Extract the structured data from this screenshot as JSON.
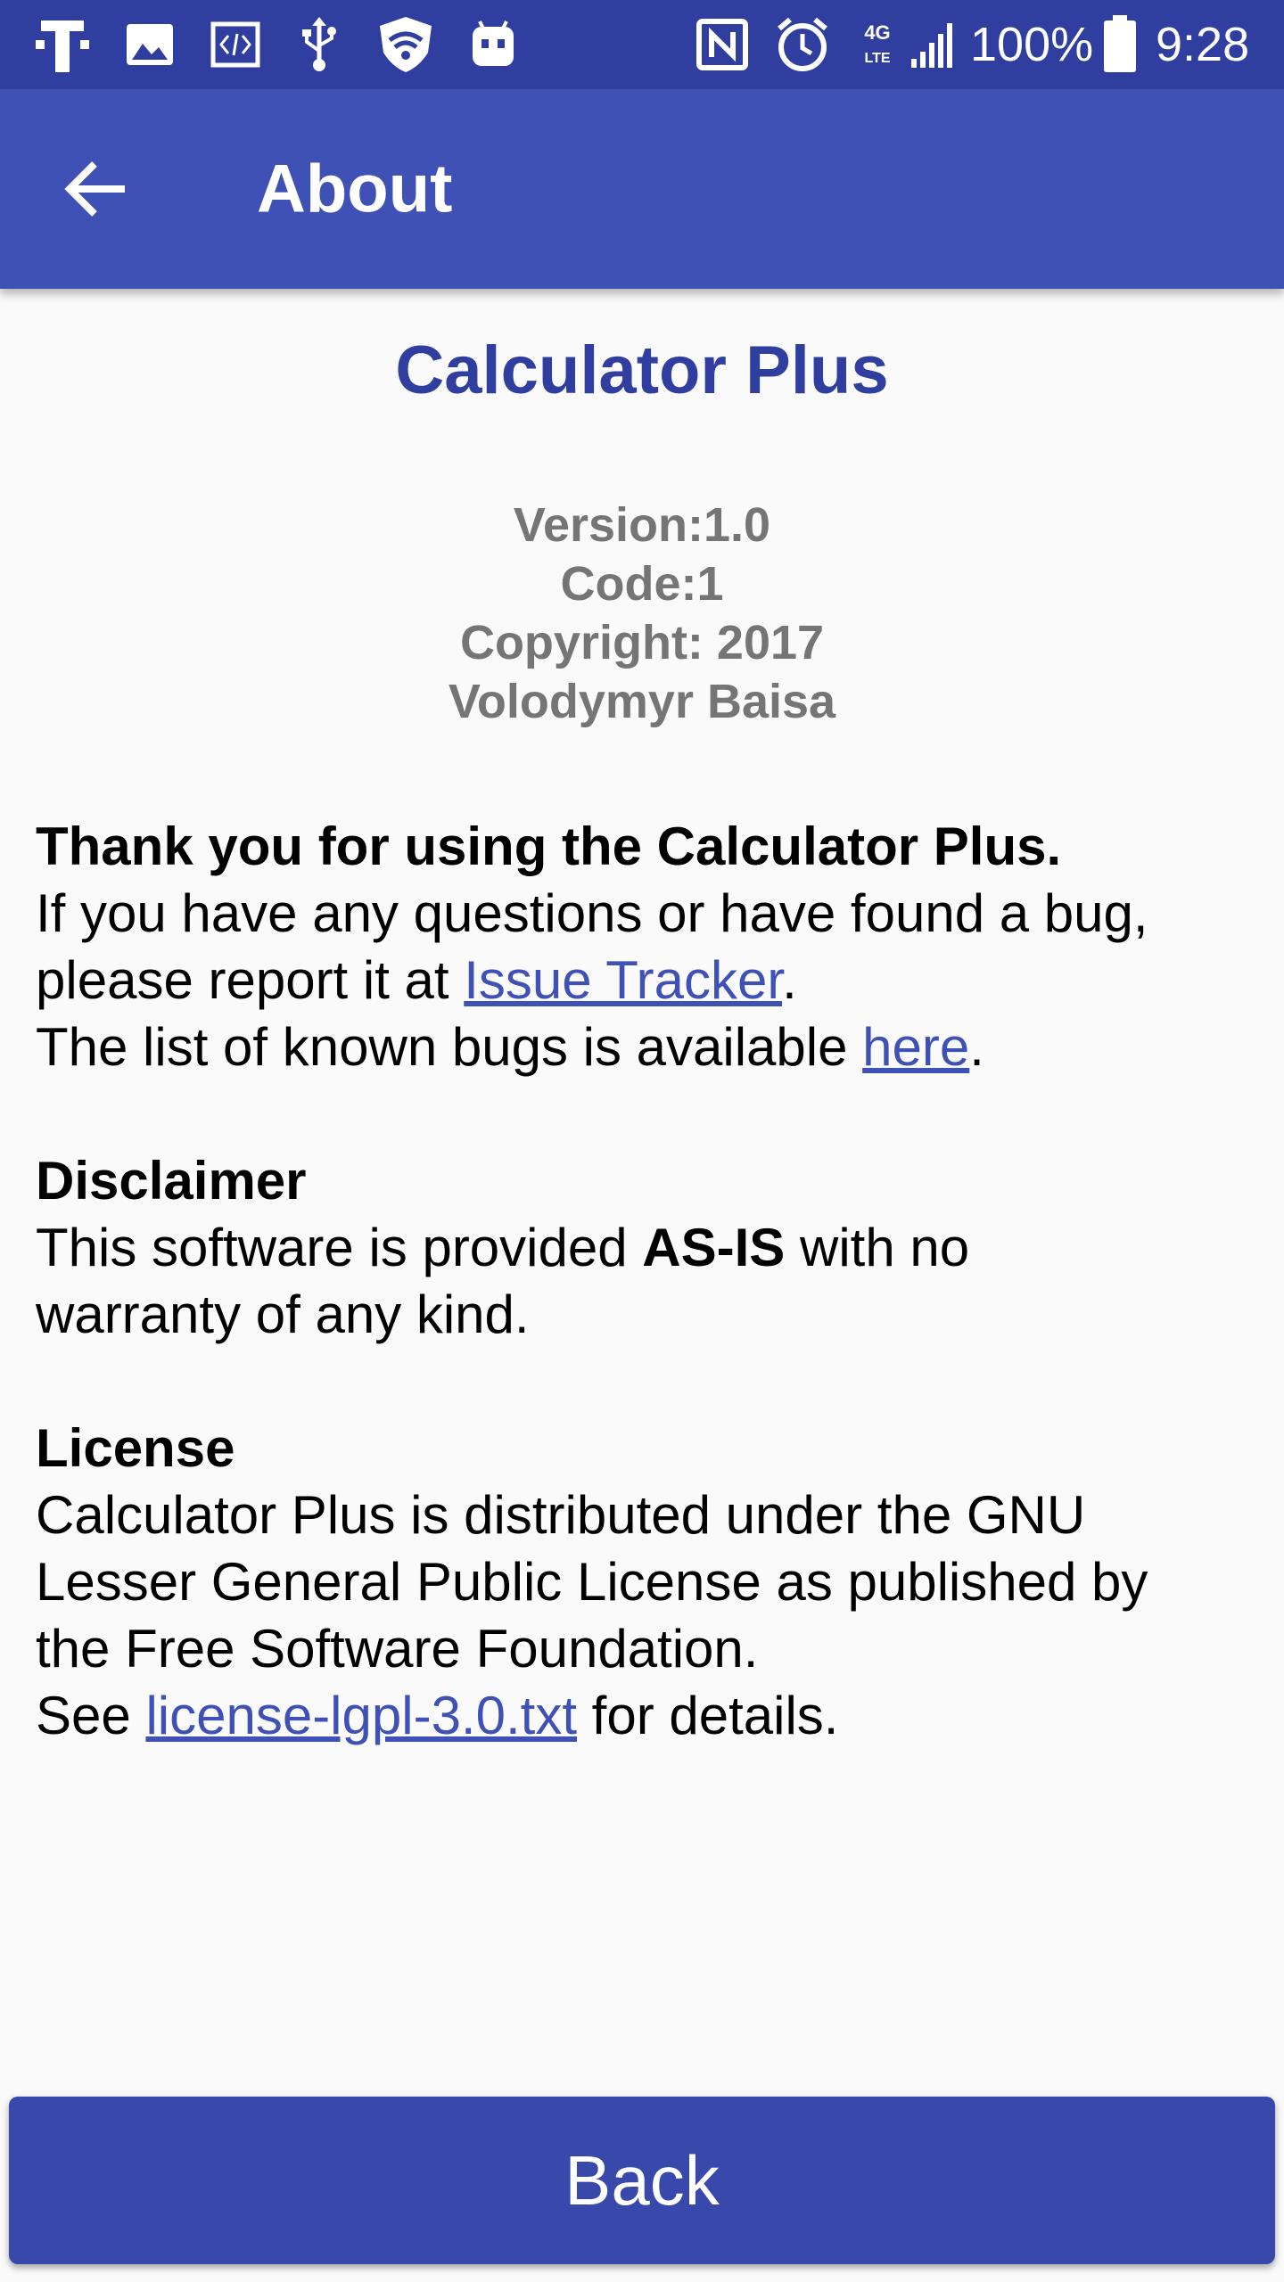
{
  "status_bar": {
    "icons_left": [
      "tmobile-icon",
      "image-icon",
      "code-icon",
      "usb-icon",
      "shield-wifi-icon",
      "android-icon"
    ],
    "icons_right": [
      "nfc-icon",
      "alarm-icon",
      "4g-lte-icon",
      "signal-icon",
      "battery-icon"
    ],
    "network_label": "4G",
    "battery_percent": "100%",
    "time": "9:28"
  },
  "app_bar": {
    "title": "About",
    "back_icon": "arrow-left-icon"
  },
  "about": {
    "app_name": "Calculator Plus",
    "version": "Version:1.0",
    "code": "Code:1",
    "copyright": "Copyright: 2017",
    "author": "Volodymyr Baisa"
  },
  "thanks": {
    "heading": "Thank you for using the Calculator Plus.",
    "line1": "If you have any questions or have found a bug,",
    "line2_prefix": "please report it at ",
    "issue_link": "Issue Tracker",
    "line2_suffix": ".",
    "line3_prefix": "The list of known bugs is available ",
    "here_link": "here",
    "line3_suffix": "."
  },
  "disclaimer": {
    "heading": "Disclaimer",
    "line1_prefix": "This software is provided ",
    "line1_bold": "AS-IS",
    "line1_suffix": " with no",
    "line2": "warranty of any kind."
  },
  "license": {
    "heading": "License",
    "line1": "Calculator Plus is distributed under the GNU",
    "line2": "Lesser General Public License as published by",
    "line3": "the Free Software Foundation.",
    "line4_prefix": "See ",
    "license_link": "license-lgpl-3.0.txt",
    "line4_suffix": " for details."
  },
  "footer": {
    "back_label": "Back"
  },
  "colors": {
    "status_bar": "#303f9f",
    "app_bar": "#3f51b5",
    "title_text": "#303f9f",
    "info_text": "#757575",
    "link": "#3f51b5",
    "button": "#3949ab"
  }
}
